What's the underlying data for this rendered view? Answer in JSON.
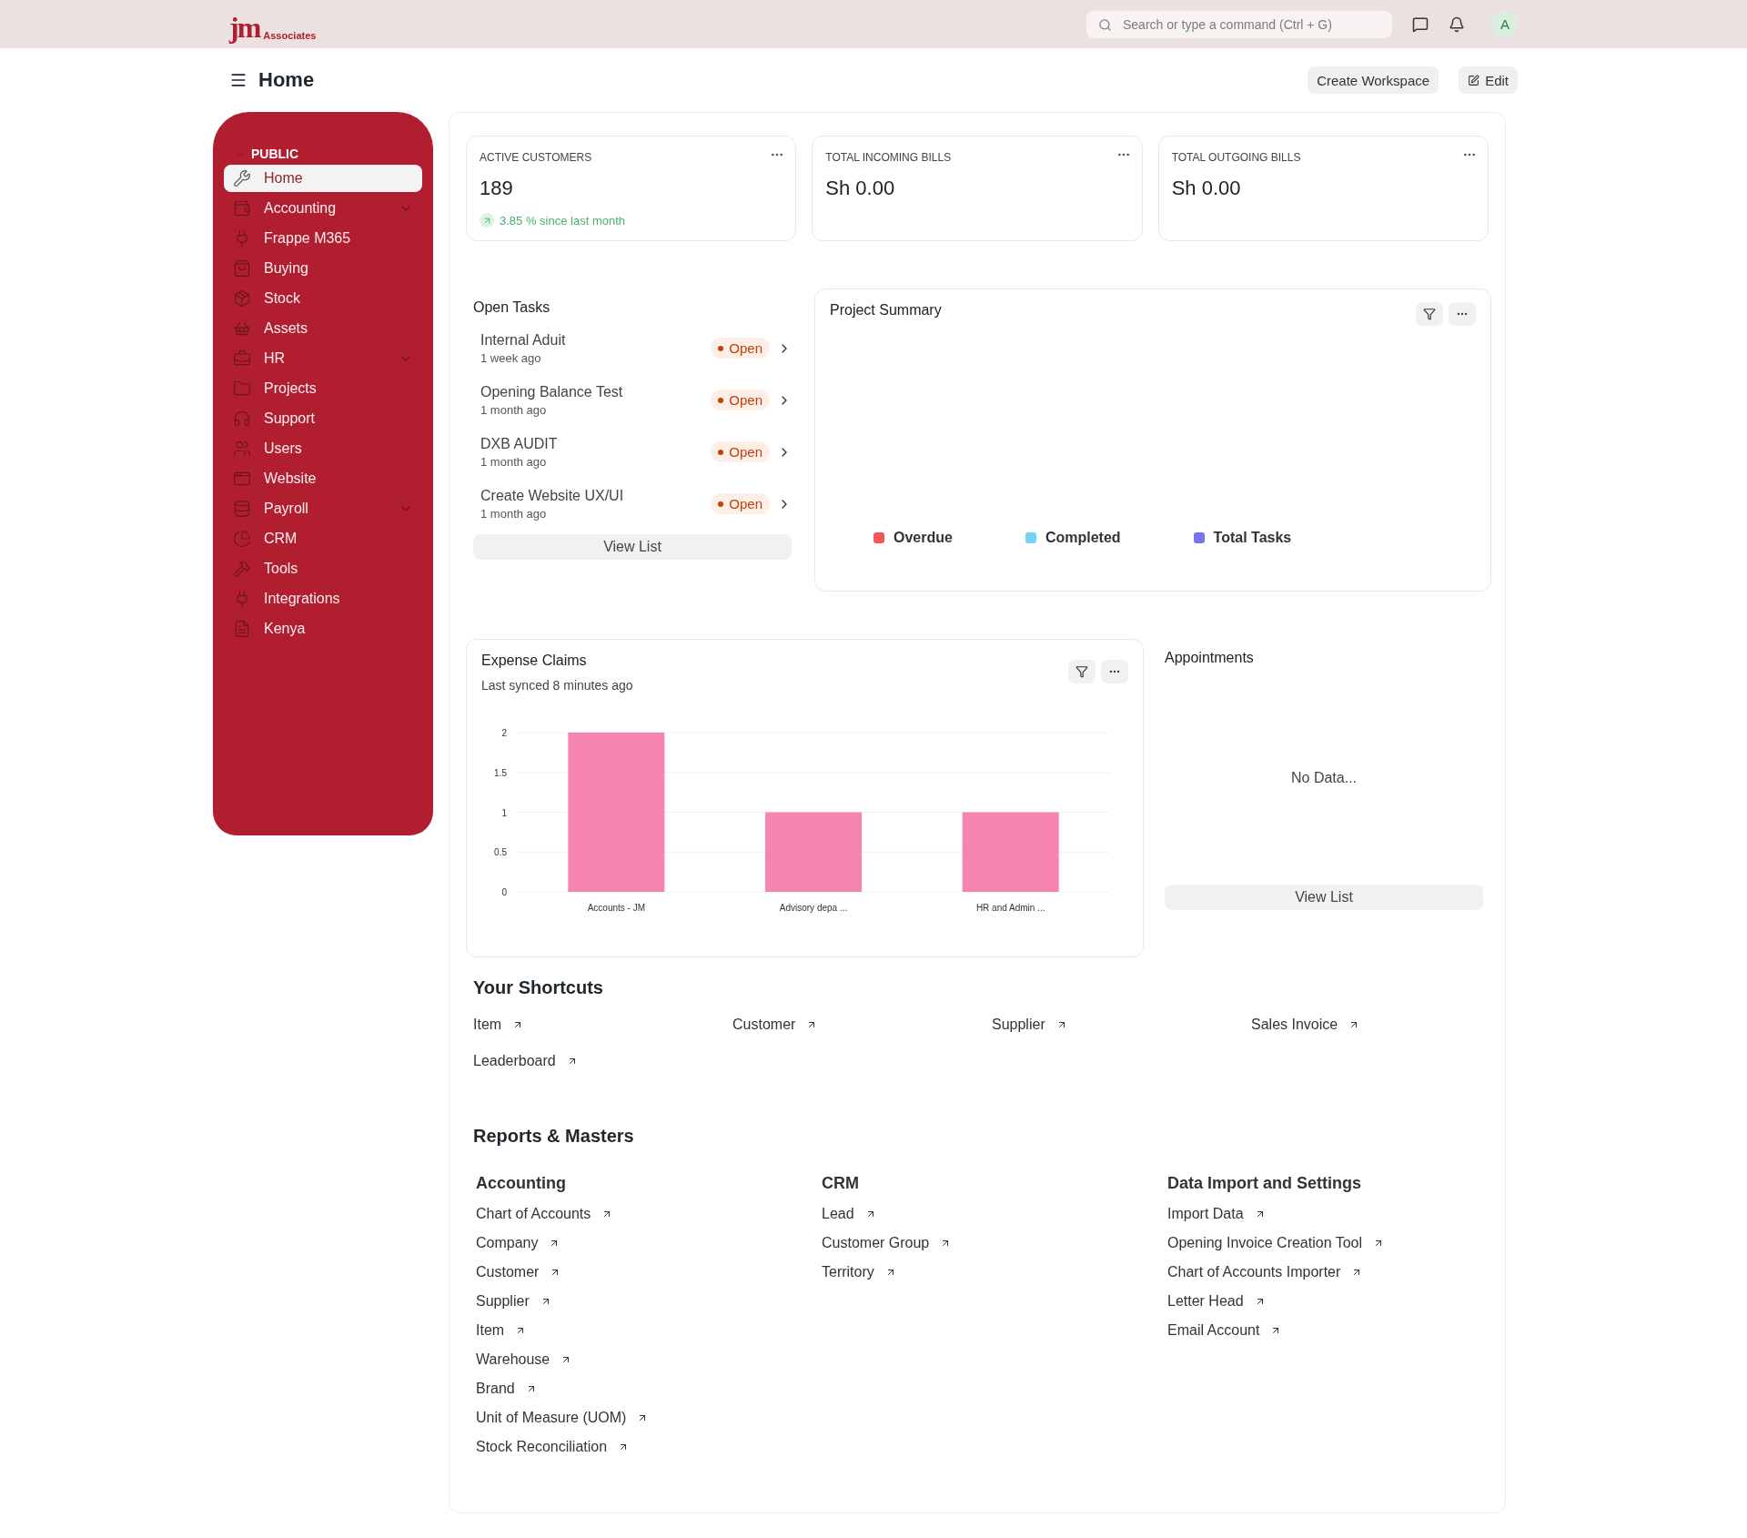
{
  "navbar": {
    "logo_main": "jm",
    "logo_sub": "Associates",
    "search": {
      "placeholder": "Search or type a command (Ctrl + G)"
    },
    "avatar": "A"
  },
  "page": {
    "title": "Home",
    "buttons": [
      {
        "label": "Create Workspace",
        "kind": "plain"
      },
      {
        "label": "Edit",
        "kind": "edit"
      }
    ]
  },
  "sidebar": {
    "section": "PUBLIC",
    "items": [
      {
        "label": "Home",
        "selected": true,
        "has_children": false
      },
      {
        "label": "Accounting",
        "selected": false,
        "has_children": true
      },
      {
        "label": "Frappe M365",
        "selected": false,
        "has_children": false
      },
      {
        "label": "Buying",
        "selected": false,
        "has_children": false
      },
      {
        "label": "Stock",
        "selected": false,
        "has_children": false
      },
      {
        "label": "Assets",
        "selected": false,
        "has_children": false
      },
      {
        "label": "HR",
        "selected": false,
        "has_children": true
      },
      {
        "label": "Projects",
        "selected": false,
        "has_children": false
      },
      {
        "label": "Support",
        "selected": false,
        "has_children": false
      },
      {
        "label": "Users",
        "selected": false,
        "has_children": false
      },
      {
        "label": "Website",
        "selected": false,
        "has_children": false
      },
      {
        "label": "Payroll",
        "selected": false,
        "has_children": true
      },
      {
        "label": "CRM",
        "selected": false,
        "has_children": false
      },
      {
        "label": "Tools",
        "selected": false,
        "has_children": false
      },
      {
        "label": "Integrations",
        "selected": false,
        "has_children": false
      },
      {
        "label": "Kenya",
        "selected": false,
        "has_children": false
      }
    ]
  },
  "number_cards": [
    {
      "title": "ACTIVE CUSTOMERS",
      "value": "189",
      "trend": "3.85 % since last month"
    },
    {
      "title": "TOTAL INCOMING BILLS",
      "value": "Sh 0.00"
    },
    {
      "title": "TOTAL OUTGOING BILLS",
      "value": "Sh 0.00"
    }
  ],
  "open_tasks": {
    "title": "Open Tasks",
    "items": [
      {
        "title": "Internal Aduit",
        "time": "1 week ago",
        "status": "Open"
      },
      {
        "title": "Opening Balance Test",
        "time": "1 month ago",
        "status": "Open"
      },
      {
        "title": "DXB AUDIT",
        "time": "1 month ago",
        "status": "Open"
      },
      {
        "title": "Create Website UX/UI",
        "time": "1 month ago",
        "status": "Open"
      }
    ],
    "button": "View List"
  },
  "project_summary": {
    "title": "Project Summary",
    "legend": [
      {
        "label": "Overdue",
        "color": "#f25757"
      },
      {
        "label": "Completed",
        "color": "#74d1f7"
      },
      {
        "label": "Total Tasks",
        "color": "#7575f0"
      }
    ]
  },
  "expense_claims": {
    "title": "Expense Claims",
    "subtitle": "Last synced 8 minutes ago",
    "chart_data": {
      "type": "bar",
      "categories": [
        "Accounts - JM",
        "Advisory depa ...",
        "HR and Admin ..."
      ],
      "series": [
        {
          "color": "#f584b0",
          "values": [
            2,
            1,
            1
          ]
        }
      ],
      "grid": true,
      "ylim": [
        0,
        2
      ],
      "yticks": [
        0,
        {
          "value": 0.5,
          "label": "0.5"
        },
        1,
        {
          "value": 1.5,
          "label": "1.5"
        },
        2
      ]
    }
  },
  "appointments": {
    "title": "Appointments",
    "empty": "No Data...",
    "button": "View List"
  },
  "shortcuts": {
    "title": "Your Shortcuts",
    "items": [
      "Item",
      "Customer",
      "Supplier",
      "Sales Invoice",
      "Leaderboard"
    ]
  },
  "reports": {
    "title": "Reports & Masters",
    "groups": [
      {
        "title": "Accounting",
        "links": [
          "Chart of Accounts",
          "Company",
          "Customer",
          "Supplier",
          "Item",
          "Warehouse",
          "Brand",
          "Unit of Measure (UOM)",
          "Stock Reconciliation"
        ]
      },
      {
        "title": "CRM",
        "links": [
          "Lead",
          "Customer Group",
          "Territory"
        ]
      },
      {
        "title": "Data Import and Settings",
        "links": [
          "Import Data",
          "Opening Invoice Creation Tool",
          "Chart of Accounts Importer",
          "Letter Head",
          "Email Account"
        ]
      }
    ]
  }
}
